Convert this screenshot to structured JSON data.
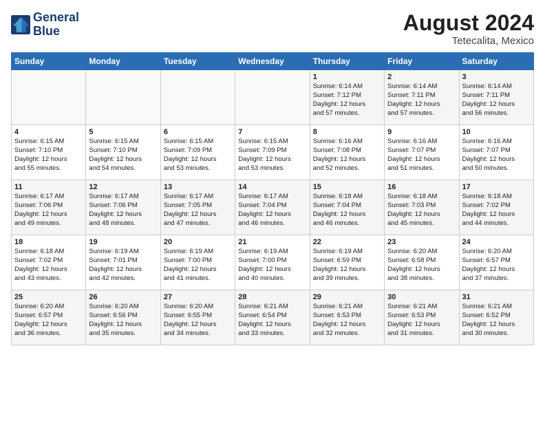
{
  "logo": {
    "name": "GeneralBlue",
    "line1": "General",
    "line2": "Blue"
  },
  "calendar": {
    "title": "August 2024",
    "subtitle": "Tetecalita, Mexico"
  },
  "headers": [
    "Sunday",
    "Monday",
    "Tuesday",
    "Wednesday",
    "Thursday",
    "Friday",
    "Saturday"
  ],
  "weeks": [
    {
      "days": [
        {
          "num": "",
          "content": ""
        },
        {
          "num": "",
          "content": ""
        },
        {
          "num": "",
          "content": ""
        },
        {
          "num": "",
          "content": ""
        },
        {
          "num": "1",
          "content": "Sunrise: 6:14 AM\nSunset: 7:12 PM\nDaylight: 12 hours\nand 57 minutes."
        },
        {
          "num": "2",
          "content": "Sunrise: 6:14 AM\nSunset: 7:11 PM\nDaylight: 12 hours\nand 57 minutes."
        },
        {
          "num": "3",
          "content": "Sunrise: 6:14 AM\nSunset: 7:11 PM\nDaylight: 12 hours\nand 56 minutes."
        }
      ]
    },
    {
      "days": [
        {
          "num": "4",
          "content": "Sunrise: 6:15 AM\nSunset: 7:10 PM\nDaylight: 12 hours\nand 55 minutes."
        },
        {
          "num": "5",
          "content": "Sunrise: 6:15 AM\nSunset: 7:10 PM\nDaylight: 12 hours\nand 54 minutes."
        },
        {
          "num": "6",
          "content": "Sunrise: 6:15 AM\nSunset: 7:09 PM\nDaylight: 12 hours\nand 53 minutes."
        },
        {
          "num": "7",
          "content": "Sunrise: 6:15 AM\nSunset: 7:09 PM\nDaylight: 12 hours\nand 53 minutes."
        },
        {
          "num": "8",
          "content": "Sunrise: 6:16 AM\nSunset: 7:08 PM\nDaylight: 12 hours\nand 52 minutes."
        },
        {
          "num": "9",
          "content": "Sunrise: 6:16 AM\nSunset: 7:07 PM\nDaylight: 12 hours\nand 51 minutes."
        },
        {
          "num": "10",
          "content": "Sunrise: 6:16 AM\nSunset: 7:07 PM\nDaylight: 12 hours\nand 50 minutes."
        }
      ]
    },
    {
      "days": [
        {
          "num": "11",
          "content": "Sunrise: 6:17 AM\nSunset: 7:06 PM\nDaylight: 12 hours\nand 49 minutes."
        },
        {
          "num": "12",
          "content": "Sunrise: 6:17 AM\nSunset: 7:06 PM\nDaylight: 12 hours\nand 48 minutes."
        },
        {
          "num": "13",
          "content": "Sunrise: 6:17 AM\nSunset: 7:05 PM\nDaylight: 12 hours\nand 47 minutes."
        },
        {
          "num": "14",
          "content": "Sunrise: 6:17 AM\nSunset: 7:04 PM\nDaylight: 12 hours\nand 46 minutes."
        },
        {
          "num": "15",
          "content": "Sunrise: 6:18 AM\nSunset: 7:04 PM\nDaylight: 12 hours\nand 46 minutes."
        },
        {
          "num": "16",
          "content": "Sunrise: 6:18 AM\nSunset: 7:03 PM\nDaylight: 12 hours\nand 45 minutes."
        },
        {
          "num": "17",
          "content": "Sunrise: 6:18 AM\nSunset: 7:02 PM\nDaylight: 12 hours\nand 44 minutes."
        }
      ]
    },
    {
      "days": [
        {
          "num": "18",
          "content": "Sunrise: 6:18 AM\nSunset: 7:02 PM\nDaylight: 12 hours\nand 43 minutes."
        },
        {
          "num": "19",
          "content": "Sunrise: 6:19 AM\nSunset: 7:01 PM\nDaylight: 12 hours\nand 42 minutes."
        },
        {
          "num": "20",
          "content": "Sunrise: 6:19 AM\nSunset: 7:00 PM\nDaylight: 12 hours\nand 41 minutes."
        },
        {
          "num": "21",
          "content": "Sunrise: 6:19 AM\nSunset: 7:00 PM\nDaylight: 12 hours\nand 40 minutes."
        },
        {
          "num": "22",
          "content": "Sunrise: 6:19 AM\nSunset: 6:59 PM\nDaylight: 12 hours\nand 39 minutes."
        },
        {
          "num": "23",
          "content": "Sunrise: 6:20 AM\nSunset: 6:58 PM\nDaylight: 12 hours\nand 38 minutes."
        },
        {
          "num": "24",
          "content": "Sunrise: 6:20 AM\nSunset: 6:57 PM\nDaylight: 12 hours\nand 37 minutes."
        }
      ]
    },
    {
      "days": [
        {
          "num": "25",
          "content": "Sunrise: 6:20 AM\nSunset: 6:57 PM\nDaylight: 12 hours\nand 36 minutes."
        },
        {
          "num": "26",
          "content": "Sunrise: 6:20 AM\nSunset: 6:56 PM\nDaylight: 12 hours\nand 35 minutes."
        },
        {
          "num": "27",
          "content": "Sunrise: 6:20 AM\nSunset: 6:55 PM\nDaylight: 12 hours\nand 34 minutes."
        },
        {
          "num": "28",
          "content": "Sunrise: 6:21 AM\nSunset: 6:54 PM\nDaylight: 12 hours\nand 33 minutes."
        },
        {
          "num": "29",
          "content": "Sunrise: 6:21 AM\nSunset: 6:53 PM\nDaylight: 12 hours\nand 32 minutes."
        },
        {
          "num": "30",
          "content": "Sunrise: 6:21 AM\nSunset: 6:53 PM\nDaylight: 12 hours\nand 31 minutes."
        },
        {
          "num": "31",
          "content": "Sunrise: 6:21 AM\nSunset: 6:52 PM\nDaylight: 12 hours\nand 30 minutes."
        }
      ]
    }
  ]
}
